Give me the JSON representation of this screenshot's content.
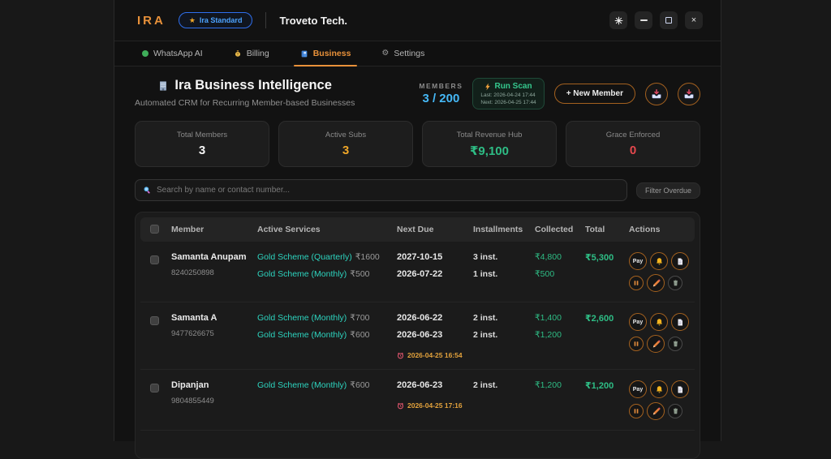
{
  "titlebar": {
    "brand": "IRA",
    "plan_badge": "Ira Standard",
    "org_name": "Troveto Tech.",
    "controls": [
      "theme",
      "minimize",
      "maximize",
      "close"
    ],
    "close_glyph": "×"
  },
  "nav": {
    "tabs": [
      {
        "label": "WhatsApp AI",
        "icon": "status-dot-green",
        "active": false
      },
      {
        "label": "Billing",
        "icon": "coin-icon",
        "active": false
      },
      {
        "label": "Business",
        "icon": "book-icon",
        "active": true
      },
      {
        "label": "Settings",
        "icon": "gear-icon",
        "active": false
      }
    ]
  },
  "header": {
    "icon": "building-icon",
    "title": "Ira Business Intelligence",
    "subtitle": "Automated CRM for Recurring Member-based Businesses",
    "members_label": "MEMBERS",
    "members_value": "3 / 200",
    "run_scan": {
      "label": "Run Scan",
      "icon": "lightning-icon",
      "last": "Last: 2026-04-24 17:44",
      "next": "Next: 2026-04-25 17:44"
    },
    "new_member_label": "+ New Member",
    "import_buttons": [
      "import-icon",
      "import-icon"
    ]
  },
  "stats": [
    {
      "label": "Total Members",
      "value": "3",
      "color": "#f5f5f5"
    },
    {
      "label": "Active Subs",
      "value": "3",
      "color": "#f0a728"
    },
    {
      "label": "Total Revenue Hub",
      "value": "₹9,100",
      "color": "#2ebd85"
    },
    {
      "label": "Grace Enforced",
      "value": "0",
      "color": "#e5484d"
    }
  ],
  "search": {
    "placeholder": "Search by name or contact number...",
    "icon": "search-icon",
    "filter_label": "Filter Overdue"
  },
  "table": {
    "columns": [
      "Member",
      "Active Services",
      "Next Due",
      "Installments",
      "Collected",
      "Total",
      "Actions"
    ],
    "row_actions": [
      {
        "name": "pay-button",
        "label": "Pay",
        "row": 1,
        "size": "normal"
      },
      {
        "name": "notify-button",
        "icon": "bell-icon",
        "row": 1,
        "size": "normal"
      },
      {
        "name": "receipt-button",
        "icon": "document-icon",
        "row": 1,
        "size": "normal"
      },
      {
        "name": "pause-button",
        "icon": "pause-icon",
        "row": 2,
        "size": "small"
      },
      {
        "name": "edit-button",
        "icon": "pencil-icon",
        "row": 2,
        "size": "normal"
      },
      {
        "name": "delete-button",
        "icon": "trash-icon",
        "row": 2,
        "size": "small",
        "dim": true
      }
    ],
    "rows": [
      {
        "name": "Samanta Anupam",
        "phone": "8240250898",
        "services": [
          {
            "plan": "Gold Scheme (Quarterly)",
            "price": "₹1600"
          },
          {
            "plan": "Gold Scheme (Monthly)",
            "price": "₹500"
          }
        ],
        "due_dates": [
          "2027-10-15",
          "2026-07-22"
        ],
        "overdue": "",
        "installments": [
          "3 inst.",
          "1 inst."
        ],
        "collected": [
          "₹4,800",
          "₹500"
        ],
        "total": "₹5,300"
      },
      {
        "name": "Samanta A",
        "phone": "9477626675",
        "services": [
          {
            "plan": "Gold Scheme (Monthly)",
            "price": "₹700"
          },
          {
            "plan": "Gold Scheme (Monthly)",
            "price": "₹600"
          }
        ],
        "due_dates": [
          "2026-06-22",
          "2026-06-23"
        ],
        "overdue": "2026-04-25 16:54",
        "installments": [
          "2 inst.",
          "2 inst."
        ],
        "collected": [
          "₹1,400",
          "₹1,200"
        ],
        "total": "₹2,600"
      },
      {
        "name": "Dipanjan",
        "phone": "9804855449",
        "services": [
          {
            "plan": "Gold Scheme (Monthly)",
            "price": "₹600"
          }
        ],
        "due_dates": [
          "2026-06-23"
        ],
        "overdue": "2026-04-25 17:16",
        "installments": [
          "2 inst."
        ],
        "collected": [
          "₹1,200"
        ],
        "total": "₹1,200"
      }
    ]
  },
  "colors": {
    "accent_orange": "#e8913a",
    "teal": "#2dd4bf",
    "green": "#2ebd85",
    "cyan": "#45b7f5",
    "red": "#e5484d",
    "amber": "#f0a728"
  }
}
